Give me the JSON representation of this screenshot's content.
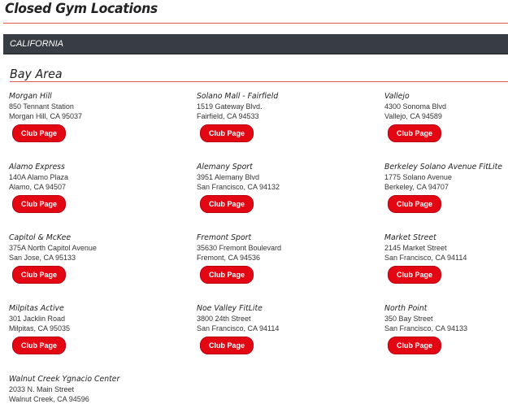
{
  "page": {
    "title": "Closed Gym Locations"
  },
  "state": {
    "name": "CALIFORNIA"
  },
  "region": {
    "name": "Bay Area"
  },
  "button_label": "Club Page",
  "clubs": [
    {
      "name": "Morgan Hill",
      "street": "850 Tennant Station",
      "city": "Morgan Hill, CA 95037"
    },
    {
      "name": "Solano Mall - Fairfield",
      "street": "1519 Gateway Blvd.",
      "city": "Fairfield, CA 94533"
    },
    {
      "name": "Vallejo",
      "street": "4300 Sonoma Blvd",
      "city": "Vallejo, CA 94589"
    },
    {
      "name": "Alamo Express",
      "street": "140A Alamo Plaza",
      "city": "Alamo, CA 94507"
    },
    {
      "name": "Alemany Sport",
      "street": "3951 Alemany Blvd",
      "city": "San Francisco, CA 94132"
    },
    {
      "name": "Berkeley Solano Avenue FitLite",
      "street": "1775 Solano Avenue",
      "city": "Berkeley, CA 94707"
    },
    {
      "name": "Capitol & McKee",
      "street": "375A North Capitol Avenue",
      "city": "San Jose, CA 95133"
    },
    {
      "name": "Fremont Sport",
      "street": "35630 Fremont Boulevard",
      "city": "Fremont, CA 94536"
    },
    {
      "name": "Market Street",
      "street": "2145 Market Street",
      "city": "San Francisco, CA 94114"
    },
    {
      "name": "Milpitas Active",
      "street": "301 Jacklin Road",
      "city": "Milpitas, CA 95035"
    },
    {
      "name": "Noe Valley FitLite",
      "street": "3800 24th Street",
      "city": "San Francisco, CA 94114"
    },
    {
      "name": "North Point",
      "street": "350 Bay Street",
      "city": "San Francisco, CA 94133"
    },
    {
      "name": "Walnut Creek Ygnacio Center",
      "street": "2033 N. Main Street",
      "city": "Walnut Creek, CA 94596"
    }
  ]
}
